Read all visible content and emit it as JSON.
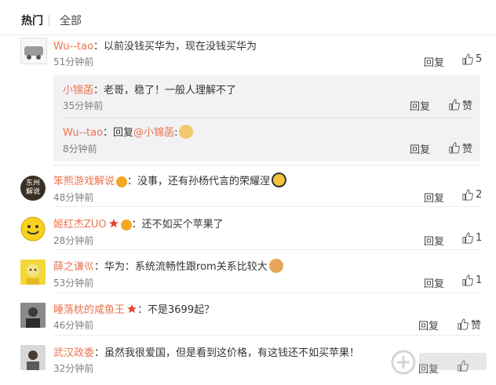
{
  "tabs": {
    "hot": "热门",
    "all": "全部"
  },
  "comments": [
    {
      "user": "Wu--tao",
      "text": "：以前没钱买华为，现在没钱买华为",
      "time": "51分钟前",
      "reply": "回复",
      "likes": "5",
      "replies": [
        {
          "user": "小锦菡",
          "text": "：老哥，稳了！一般人理解不了",
          "time": "35分钟前",
          "reply": "回复",
          "likes": "赞"
        },
        {
          "user": "Wu--tao",
          "text_prefix": "：回复",
          "mention": "@小锦菡",
          "text": ":",
          "time": "8分钟前",
          "reply": "回复",
          "likes": "赞"
        }
      ]
    },
    {
      "user": "笨熊游戏解说",
      "text": "：没事，还有孙杨代言的荣耀涅",
      "time": "48分钟前",
      "reply": "回复",
      "likes": "2",
      "avatar_text": "东州解说"
    },
    {
      "user": "姬红杰ZUO",
      "text": "：还不如买个苹果了",
      "time": "28分钟前",
      "reply": "回复",
      "likes": "1"
    },
    {
      "user": "薛之谦巛",
      "text": "：华为：系统流畅性跟rom关系比较大",
      "time": "53分钟前",
      "reply": "回复",
      "likes": "1"
    },
    {
      "user": "睡落枕的咸鱼王",
      "text": "：不是3699起？",
      "time": "46分钟前",
      "reply": "回复",
      "likes": "赞"
    },
    {
      "user": "武汉政委",
      "text": "：虽然我很爱国，但是看到这价格，有这钱还不如买苹果！",
      "time": "32分钟前",
      "reply": "回复",
      "likes": ""
    }
  ],
  "colors": {
    "name": "#eb7350",
    "text": "#333333",
    "time": "#808080",
    "subbox": "#f2f2f5"
  },
  "icons": {
    "like": "thumbs-up-icon",
    "emoji": "smiley-emoji-icon"
  }
}
